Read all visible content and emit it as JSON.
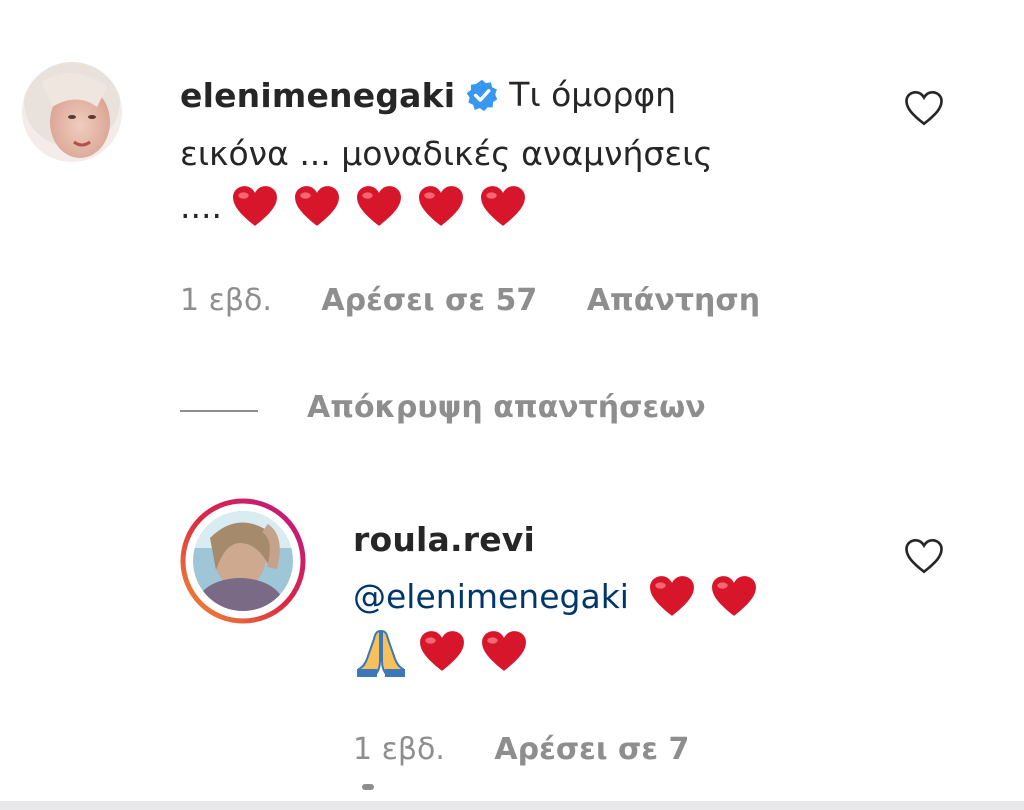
{
  "comment": {
    "username": "elenimenegaki",
    "verified": true,
    "text_line1": "Τι όμορφη",
    "text_line2": "εικόνα ... μοναδικές αναμνήσεις",
    "text_line3": "....",
    "emoji_count": 5,
    "time": "1 εβδ.",
    "likes": "Αρέσει σε 57",
    "reply_label": "Απάντηση"
  },
  "replies_toggle": {
    "label": "Απόκρυψη απαντήσεων"
  },
  "reply": {
    "username": "roula.revi",
    "mention": "@elenimenegaki",
    "time": "1 εβδ.",
    "likes": "Αρέσει σε 7"
  },
  "colors": {
    "text": "#262626",
    "meta": "#8e8e8e",
    "mention": "#00376b",
    "verified": "#3897f0",
    "heart": "#d8162b",
    "story_ring_start": "#f09433",
    "story_ring_end": "#bc1888"
  },
  "icons": [
    "heart-outline-icon",
    "verified-badge-icon",
    "red-heart-emoji",
    "praying-hands-emoji"
  ]
}
